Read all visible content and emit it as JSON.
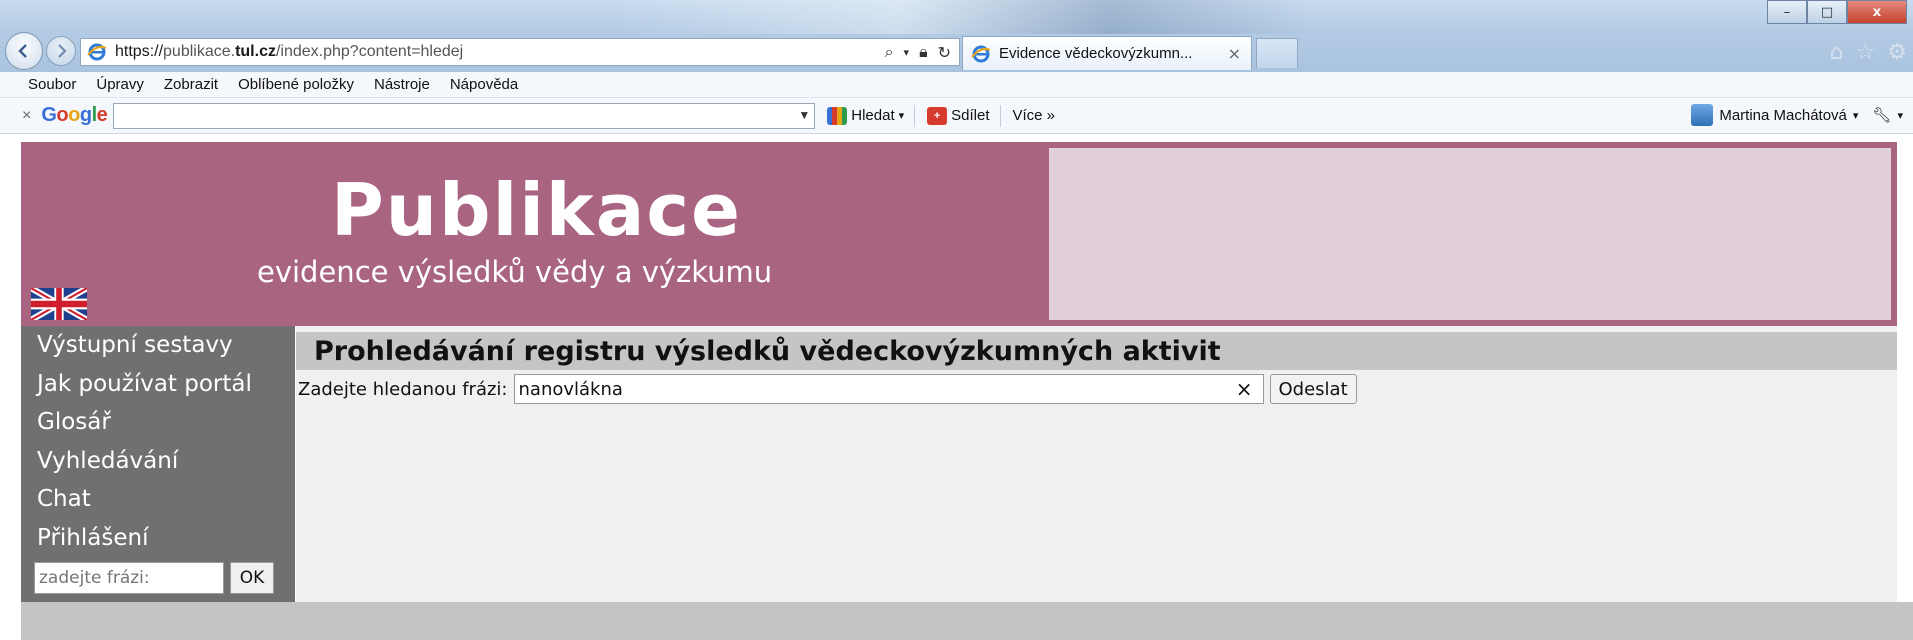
{
  "browser": {
    "address": {
      "protocol": "https://",
      "host_prefix": "publikace.",
      "host_domain": "tul.cz",
      "path": "/index.php?content=hledej"
    },
    "tab": {
      "label": "Evidence vědeckovýzkumn...",
      "close": "×"
    },
    "window_controls": {
      "minimize": "–",
      "maximize": "□",
      "close": "x"
    },
    "menu": [
      "Soubor",
      "Úpravy",
      "Zobrazit",
      "Oblíbené položky",
      "Nástroje",
      "Nápověda"
    ],
    "google_toolbar": {
      "close": "×",
      "logo": "Google",
      "search_value": "",
      "search_label": "Hledat",
      "share_label": "Sdílet",
      "more_label": "Více »",
      "user_name": "Martina Machátová"
    }
  },
  "header": {
    "title": "Publikace",
    "subtitle": "evidence výsledků vědy a výzkumu"
  },
  "sidebar": {
    "items": [
      "Výstupní sestavy",
      "Jak používat portál",
      "Glosář",
      "Vyhledávání",
      "Chat",
      "Přihlášení"
    ],
    "search_placeholder": "zadejte frázi:",
    "search_button": "OK"
  },
  "main": {
    "heading": "Prohledávání registru výsledků vědeckovýzkumných aktivit",
    "form_label": "Zadejte hledanou frázi:",
    "query_value": "nanovlákna",
    "clear": "×",
    "submit": "Odeslat"
  },
  "colors": {
    "banner": "#a86480",
    "banner_sidebox": "#e1d0d9",
    "sidebar": "#707070",
    "heading_bg": "#c5c5c5",
    "content_bg": "#f0f0f0"
  }
}
